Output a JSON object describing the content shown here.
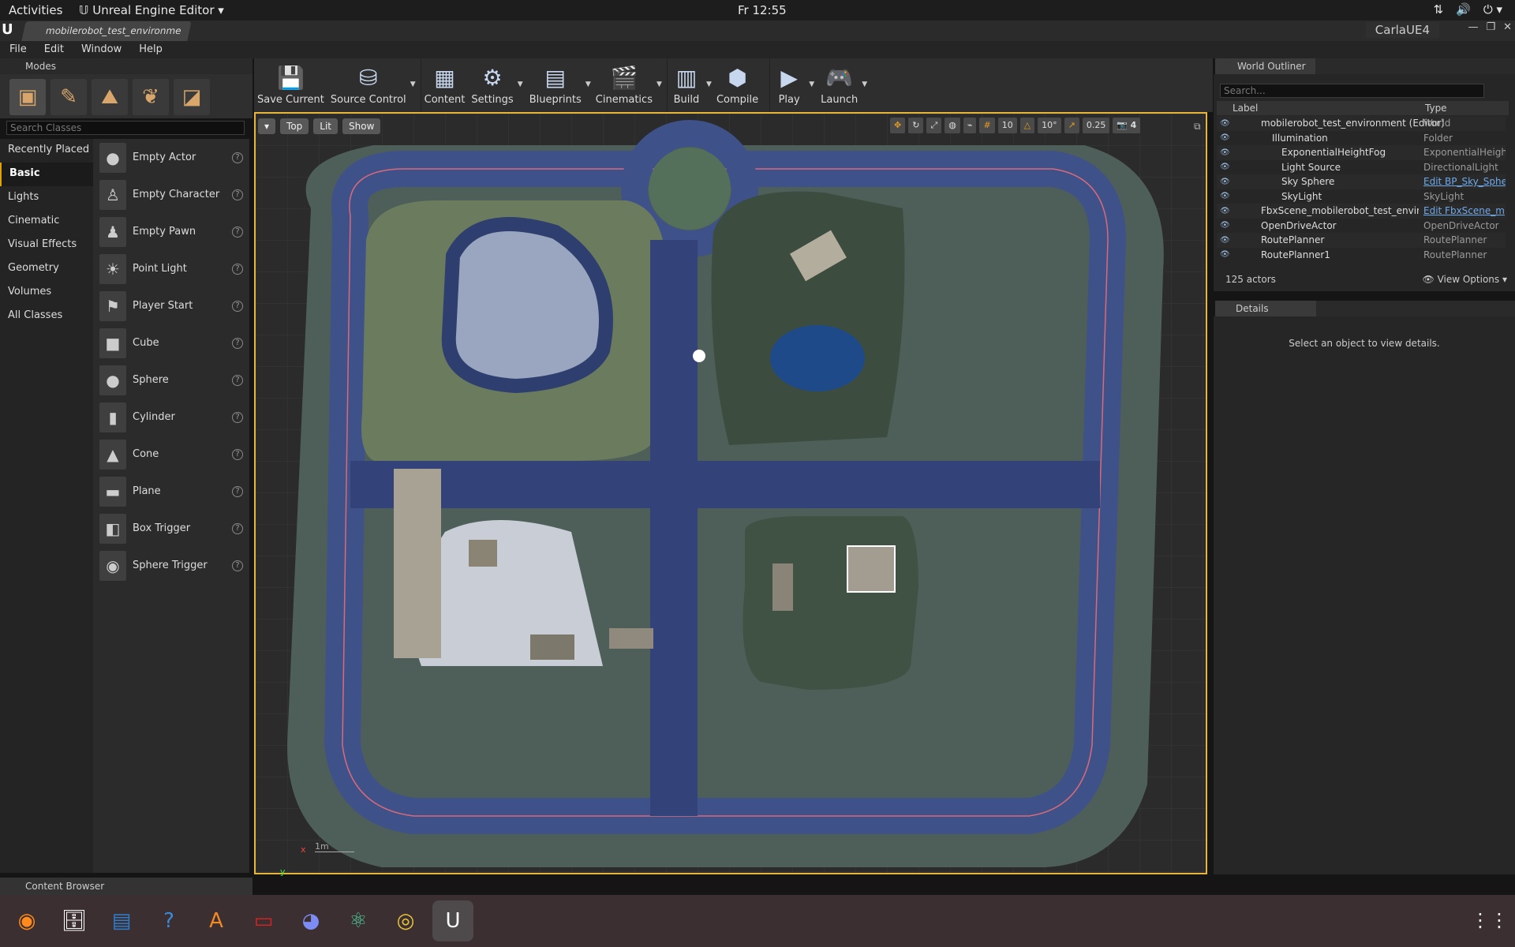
{
  "topbar": {
    "activities": "Activities",
    "app_name": "Unreal Engine Editor",
    "clock": "Fr 12:55",
    "tray_icons": [
      "network-icon",
      "volume-icon",
      "power-icon"
    ]
  },
  "window": {
    "doc_tab": "mobilerobot_test_environme",
    "project": "CarlaUE4"
  },
  "menu": [
    "File",
    "Edit",
    "Window",
    "Help"
  ],
  "modes": {
    "title": "Modes",
    "search_placeholder": "Search Classes",
    "categories": [
      "Recently Placed",
      "Basic",
      "Lights",
      "Cinematic",
      "Visual Effects",
      "Geometry",
      "Volumes",
      "All Classes"
    ],
    "active_category": "Basic",
    "items": [
      "Empty Actor",
      "Empty Character",
      "Empty Pawn",
      "Point Light",
      "Player Start",
      "Cube",
      "Sphere",
      "Cylinder",
      "Cone",
      "Plane",
      "Box Trigger",
      "Sphere Trigger"
    ]
  },
  "toolbar": [
    "Save Current",
    "Source Control",
    "Content",
    "Settings",
    "Blueprints",
    "Cinematics",
    "Build",
    "Compile",
    "Play",
    "Launch"
  ],
  "viewport": {
    "view": "Top",
    "lit": "Lit",
    "show": "Show",
    "grid": "10",
    "angle": "10°",
    "scale": "0.25",
    "speed": "4",
    "scale_label": "1m",
    "axis_x": "x",
    "axis_y": "y"
  },
  "outliner": {
    "title": "World Outliner",
    "search_placeholder": "Search...",
    "col_label": "Label",
    "col_type": "Type",
    "rows": [
      {
        "label": "mobilerobot_test_environment (Editor)",
        "type": "World",
        "link": false
      },
      {
        "label": "Illumination",
        "type": "Folder",
        "link": false
      },
      {
        "label": "ExponentialHeightFog",
        "type": "ExponentialHeightFog",
        "link": false
      },
      {
        "label": "Light Source",
        "type": "DirectionalLight",
        "link": false
      },
      {
        "label": "Sky Sphere",
        "type": "Edit BP_Sky_Sphere",
        "link": true
      },
      {
        "label": "SkyLight",
        "type": "SkyLight",
        "link": false
      },
      {
        "label": "FbxScene_mobilerobot_test_environment",
        "type": "Edit FbxScene_m",
        "link": true
      },
      {
        "label": "OpenDriveActor",
        "type": "OpenDriveActor",
        "link": false
      },
      {
        "label": "RoutePlanner",
        "type": "RoutePlanner",
        "link": false
      },
      {
        "label": "RoutePlanner1",
        "type": "RoutePlanner",
        "link": false
      }
    ],
    "count": "125 actors",
    "view_options": "View Options"
  },
  "details": {
    "title": "Details",
    "message": "Select an object to view details."
  },
  "content_browser": "Content Browser",
  "dock": [
    "firefox-icon",
    "files-icon",
    "writer-icon",
    "help-icon",
    "software-icon",
    "terminal-icon",
    "discord-icon",
    "atom-icon",
    "chrome-icon",
    "unreal-icon"
  ]
}
